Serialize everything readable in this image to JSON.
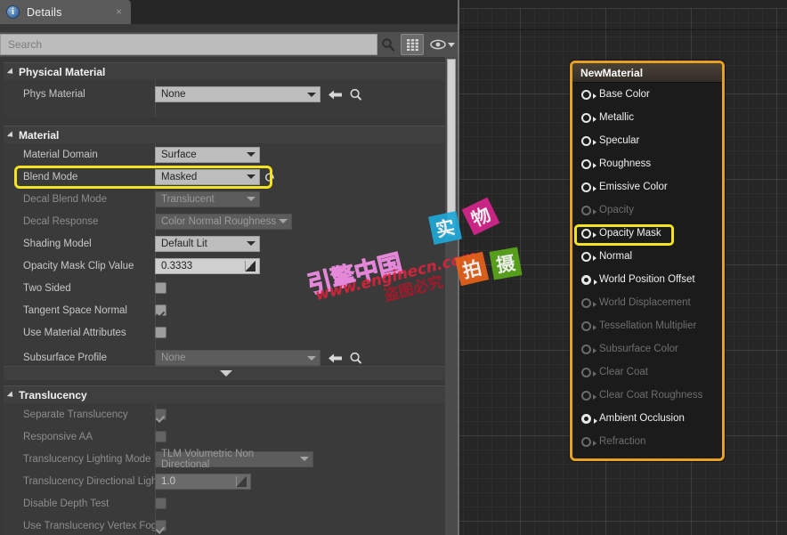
{
  "tab": {
    "label": "Details",
    "icon": "info-icon",
    "close": "×"
  },
  "search": {
    "placeholder": "Search",
    "value": "",
    "search_icon": "search-icon",
    "grid_icon": "grid-view-icon",
    "eye_icon": "eye-icon",
    "caret_icon": "chevron-down-icon"
  },
  "sections": [
    {
      "id": "physical-material",
      "title": "Physical Material",
      "rows": [
        {
          "label": "Phys Material",
          "widget": "combo-wide",
          "value": "None",
          "disabled": false,
          "has_back_arrow": true,
          "has_browse": true
        }
      ]
    },
    {
      "id": "material",
      "title": "Material",
      "rows": [
        {
          "label": "Material Domain",
          "widget": "combo",
          "value": "Surface",
          "disabled": false
        },
        {
          "label": "Blend Mode",
          "widget": "combo",
          "value": "Masked",
          "disabled": false,
          "has_reset": true,
          "highlighted": true
        },
        {
          "label": "Decal Blend Mode",
          "widget": "combo",
          "value": "Translucent",
          "disabled": true
        },
        {
          "label": "Decal Response",
          "widget": "combo-long",
          "value": "Color Normal Roughness",
          "disabled": true
        },
        {
          "label": "Shading Model",
          "widget": "combo",
          "value": "Default Lit",
          "disabled": false
        },
        {
          "label": "Opacity Mask Clip Value",
          "widget": "number",
          "value": "0.3333",
          "disabled": false
        },
        {
          "label": "Two Sided",
          "widget": "checkbox",
          "value": false,
          "disabled": false
        },
        {
          "label": "Tangent Space Normal",
          "widget": "checkbox",
          "value": true,
          "disabled": false
        },
        {
          "label": "Use Material Attributes",
          "widget": "checkbox",
          "value": false,
          "disabled": false
        },
        {
          "label": "Subsurface Profile",
          "widget": "combo-wide",
          "value": "None",
          "disabled": true,
          "has_back_arrow": true,
          "has_browse": true
        }
      ],
      "expander": "show-more-arrow"
    },
    {
      "id": "translucency",
      "title": "Translucency",
      "rows": [
        {
          "label": "Separate Translucency",
          "widget": "checkbox",
          "value": true,
          "disabled": true
        },
        {
          "label": "Responsive AA",
          "widget": "checkbox",
          "value": false,
          "disabled": true
        },
        {
          "label": "Translucency Lighting Mode",
          "widget": "combo-long",
          "value": "TLM Volumetric Non Directional",
          "disabled": true
        },
        {
          "label": "Translucency Directional Ligh",
          "widget": "number",
          "value": "1.0",
          "disabled": true
        },
        {
          "label": "Disable Depth Test",
          "widget": "checkbox",
          "value": false,
          "disabled": true
        },
        {
          "label": "Use Translucency Vertex Fog",
          "widget": "checkbox",
          "value": true,
          "disabled": true
        }
      ]
    }
  ],
  "node": {
    "title": "NewMaterial",
    "pins": [
      {
        "label": "Base Color",
        "enabled": true,
        "bold": false
      },
      {
        "label": "Metallic",
        "enabled": true,
        "bold": false
      },
      {
        "label": "Specular",
        "enabled": true,
        "bold": false
      },
      {
        "label": "Roughness",
        "enabled": true,
        "bold": false
      },
      {
        "label": "Emissive Color",
        "enabled": true,
        "bold": false
      },
      {
        "label": "Opacity",
        "enabled": false,
        "bold": false
      },
      {
        "label": "Opacity Mask",
        "enabled": true,
        "bold": false,
        "highlighted": true
      },
      {
        "label": "Normal",
        "enabled": true,
        "bold": false
      },
      {
        "label": "World Position Offset",
        "enabled": true,
        "bold": true
      },
      {
        "label": "World Displacement",
        "enabled": false,
        "bold": false
      },
      {
        "label": "Tessellation Multiplier",
        "enabled": false,
        "bold": false
      },
      {
        "label": "Subsurface Color",
        "enabled": false,
        "bold": false
      },
      {
        "label": "Clear Coat",
        "enabled": false,
        "bold": false
      },
      {
        "label": "Clear Coat Roughness",
        "enabled": false,
        "bold": false
      },
      {
        "label": "Ambient Occlusion",
        "enabled": true,
        "bold": true
      },
      {
        "label": "Refraction",
        "enabled": false,
        "bold": false
      }
    ]
  },
  "watermark": {
    "brand": "引擎中国",
    "url": "www.enginecn.com",
    "warning": "盗图必究",
    "tiles": [
      "实",
      "物",
      "拍",
      "摄"
    ]
  },
  "colors": {
    "highlight": "#f5e31f",
    "node_border": "#e8a020",
    "panel_bg": "#383838",
    "graph_bg": "#262626"
  }
}
